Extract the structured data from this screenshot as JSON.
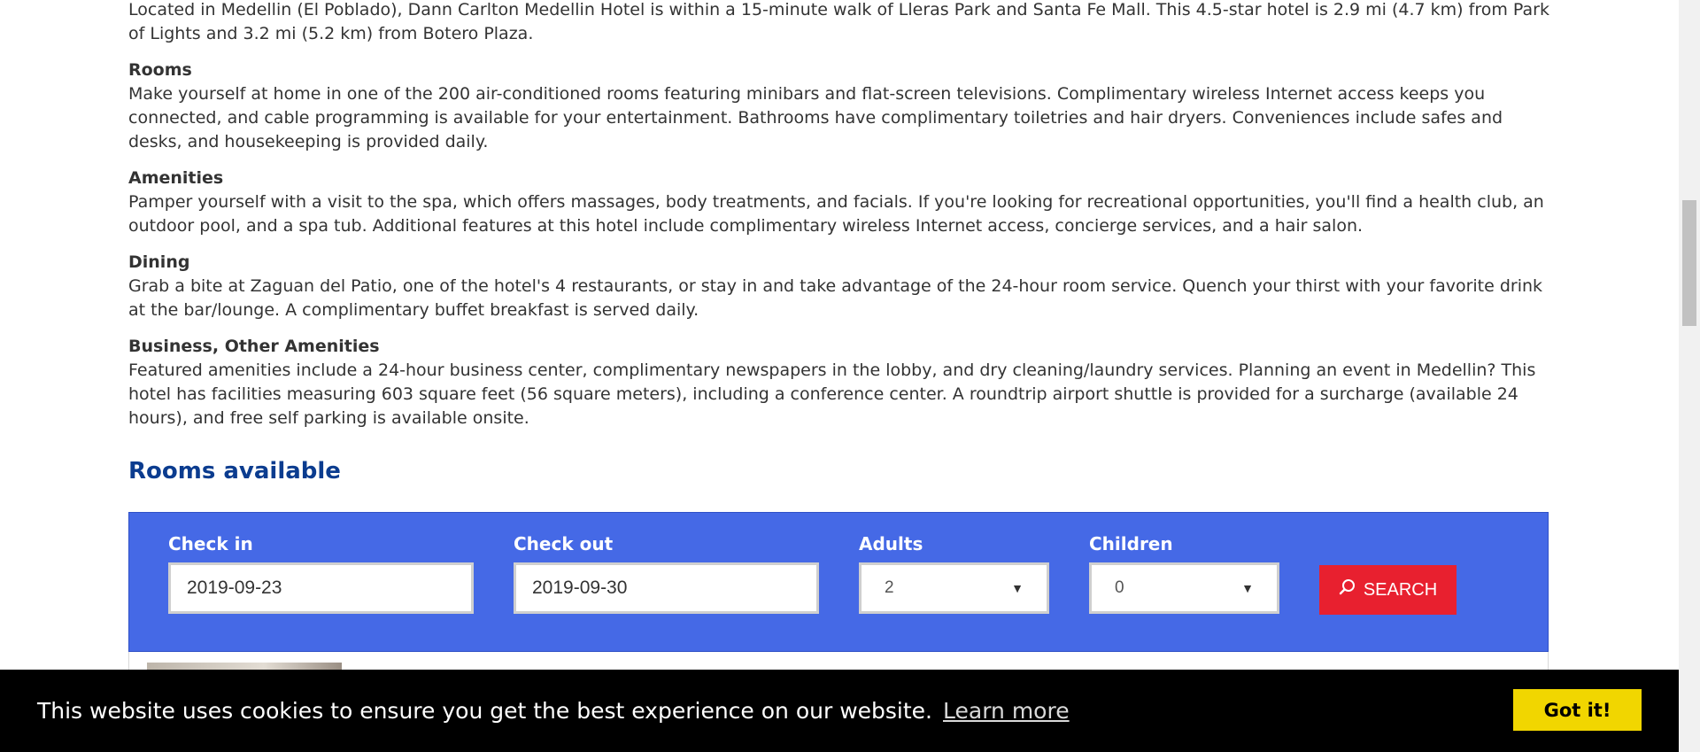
{
  "intro": "Located in Medellin (El Poblado), Dann Carlton Medellin Hotel is within a 15-minute walk of Lleras Park and Santa Fe Mall. This 4.5-star hotel is 2.9 mi (4.7 km) from Park of Lights and 3.2 mi (5.2 km) from Botero Plaza.",
  "sections": [
    {
      "title": "Rooms",
      "text": "Make yourself at home in one of the 200 air-conditioned rooms featuring minibars and flat-screen televisions. Complimentary wireless Internet access keeps you connected, and cable programming is available for your entertainment. Bathrooms have complimentary toiletries and hair dryers. Conveniences include safes and desks, and housekeeping is provided daily."
    },
    {
      "title": "Amenities",
      "text": "Pamper yourself with a visit to the spa, which offers massages, body treatments, and facials. If you're looking for recreational opportunities, you'll find a health club, an outdoor pool, and a spa tub. Additional features at this hotel include complimentary wireless Internet access, concierge services, and a hair salon."
    },
    {
      "title": "Dining",
      "text": "Grab a bite at Zaguan del Patio, one of the hotel's 4 restaurants, or stay in and take advantage of the 24-hour room service. Quench your thirst with your favorite drink at the bar/lounge. A complimentary buffet breakfast is served daily."
    },
    {
      "title": "Business, Other Amenities",
      "text": "Featured amenities include a 24-hour business center, complimentary newspapers in the lobby, and dry cleaning/laundry services. Planning an event in Medellin? This hotel has facilities measuring 603 square feet (56 square meters), including a conference center. A roundtrip airport shuttle is provided for a surcharge (available 24 hours), and free self parking is available onsite."
    }
  ],
  "rooms_heading": "Rooms available",
  "search": {
    "checkin_label": "Check in",
    "checkin_value": "2019-09-23",
    "checkout_label": "Check out",
    "checkout_value": "2019-09-30",
    "adults_label": "Adults",
    "adults_value": "2",
    "children_label": "Children",
    "children_value": "0",
    "button_label": "SEARCH",
    "button_icon": "search-icon",
    "panel_color": "#4569e6",
    "button_color": "#e8202f"
  },
  "cookie": {
    "message": "This website uses cookies to ensure you get the best experience on our website.",
    "learn_more": "Learn more",
    "accept": "Got it!",
    "accept_color": "#f1d600"
  }
}
